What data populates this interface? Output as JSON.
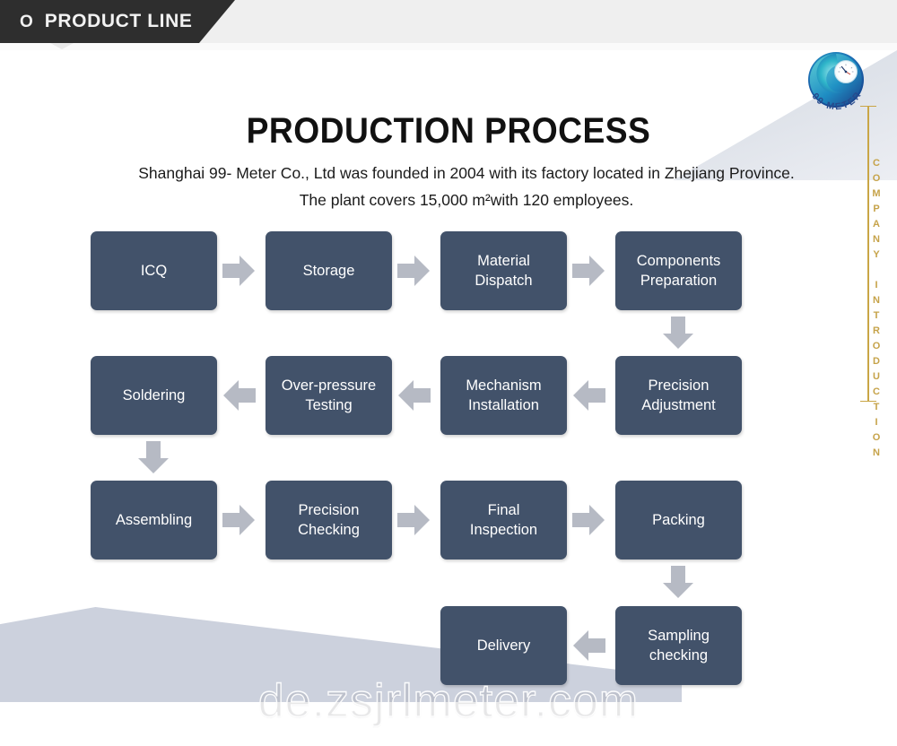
{
  "header": {
    "bullet_icon": "circle-o-icon",
    "title": "PRODUCT LINE"
  },
  "brand": {
    "logo_icon": "99meter-swirl-logo",
    "logo_text": "99 METER"
  },
  "side_rail": {
    "vertical_text": "COMPANY INTRODUCTION",
    "color": "#c6a34a"
  },
  "main": {
    "title": "PRODUCTION PROCESS",
    "paragraph": "Shanghai 99- Meter Co., Ltd was founded in 2004 with its factory located in Zhejiang Province. The plant covers 15,000 m²with 120 employees."
  },
  "colors": {
    "box_fill": "#42526a",
    "arrow_fill": "#b6bac4",
    "banner_dark": "#2e2e2e",
    "accent_gold": "#c9a646",
    "shape_gray": "#ccd1dd"
  },
  "flow": {
    "rows": [
      {
        "direction": "right",
        "steps": [
          "ICQ",
          "Storage",
          "Material\nDispatch",
          "Components\nPreparation"
        ]
      },
      {
        "direction": "left",
        "steps": [
          "Soldering",
          "Over-pressure\nTesting",
          "Mechanism\nInstallation",
          "Precision\nAdjustment"
        ]
      },
      {
        "direction": "right",
        "steps": [
          "Assembling",
          "Precision\nChecking",
          "Final\nInspection",
          "Packing"
        ]
      },
      {
        "direction": "left",
        "steps": [
          "Delivery",
          "Sampling\nchecking"
        ]
      }
    ],
    "boxes": {
      "icq": "ICQ",
      "storage": "Storage",
      "material_dispatch_l1": "Material",
      "material_dispatch_l2": "Dispatch",
      "components_prep_l1": "Components",
      "components_prep_l2": "Preparation",
      "soldering": "Soldering",
      "over_pressure_l1": "Over-pressure",
      "over_pressure_l2": "Testing",
      "mechanism_l1": "Mechanism",
      "mechanism_l2": "Installation",
      "precision_adj_l1": "Precision",
      "precision_adj_l2": "Adjustment",
      "assembling": "Assembling",
      "precision_check_l1": "Precision",
      "precision_check_l2": "Checking",
      "final_inspection_l1": "Final",
      "final_inspection_l2": "Inspection",
      "packing": "Packing",
      "delivery": "Delivery",
      "sampling_l1": "Sampling",
      "sampling_l2": "checking"
    }
  },
  "watermark": {
    "text": "de.zsjrlmeter.com"
  }
}
